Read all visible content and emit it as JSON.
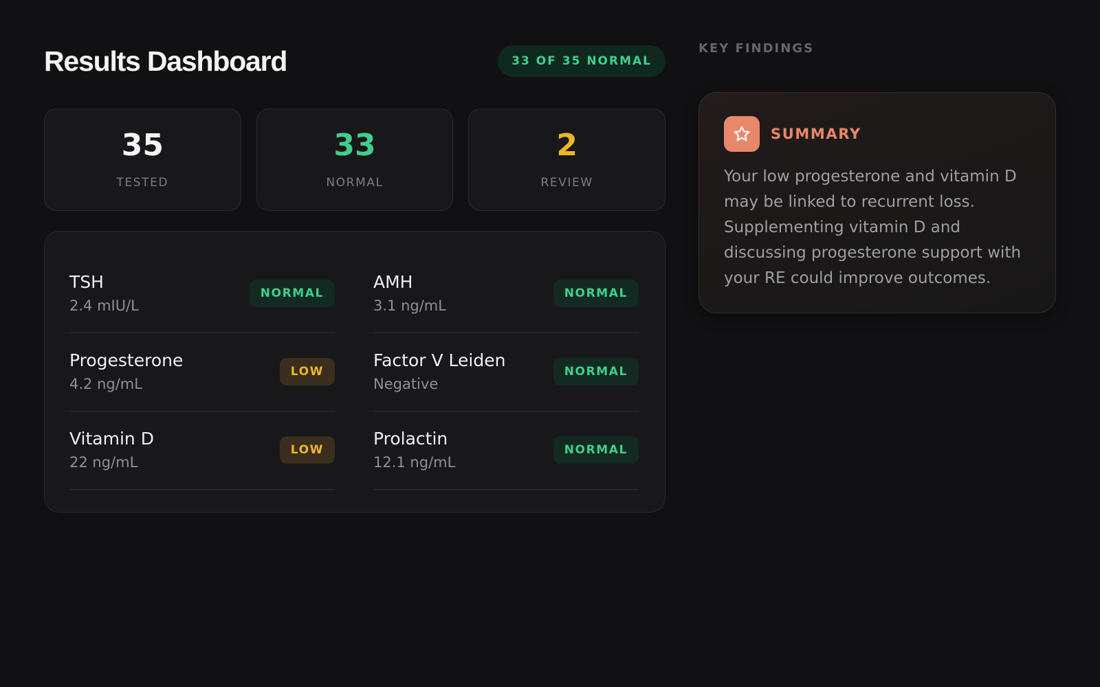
{
  "header": {
    "title": "Results Dashboard",
    "badge": "33 OF 35 NORMAL"
  },
  "stats": [
    {
      "value": "35",
      "label": "TESTED",
      "color": "#f4f4f4"
    },
    {
      "value": "33",
      "label": "NORMAL",
      "color": "#3fcf8e"
    },
    {
      "value": "2",
      "label": "REVIEW",
      "color": "#f0b623"
    }
  ],
  "results": [
    {
      "name": "TSH",
      "value": "2.4 mIU/L",
      "status": "NORMAL"
    },
    {
      "name": "AMH",
      "value": "3.1 ng/mL",
      "status": "NORMAL"
    },
    {
      "name": "Progesterone",
      "value": "4.2 ng/mL",
      "status": "LOW"
    },
    {
      "name": "Factor V Leiden",
      "value": "Negative",
      "status": "NORMAL"
    },
    {
      "name": "Vitamin D",
      "value": "22 ng/mL",
      "status": "LOW"
    },
    {
      "name": "Prolactin",
      "value": "12.1 ng/mL",
      "status": "NORMAL"
    }
  ],
  "sidebar": {
    "heading": "KEY FINDINGS",
    "summary": {
      "icon": "star-icon",
      "title": "SUMMARY",
      "text": "Your low progesterone and vitamin D may be linked to recurrent loss. Supplementing vitamin D and discussing progesterone support with your RE could improve outcomes."
    }
  },
  "colors": {
    "normal": "#3fcf8e",
    "low": "#f0b623",
    "accent": "#e8876a"
  }
}
